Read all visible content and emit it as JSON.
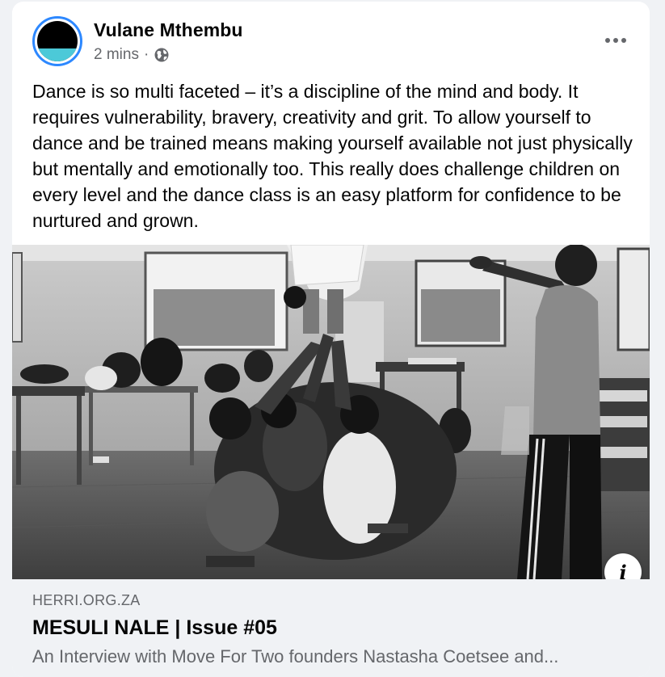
{
  "post": {
    "author": "Vulane Mthembu",
    "timestamp": "2 mins",
    "separator": "·",
    "privacy_icon": "globe-icon",
    "more_icon": "more-horizontal-icon",
    "text": "Dance is so multi faceted – it’s a discipline of the mind and body. It requires vulnerability, bravery, creativity and grit. To allow yourself to dance and be trained means making yourself available not just physically but mentally and emotionally too. This really does challenge children on every level and the dance class is an easy platform for confidence to be nurtured and grown."
  },
  "link_preview": {
    "domain": "HERRI.ORG.ZA",
    "title": "MESULI NALE | Issue #05",
    "description": "An Interview with Move For Two founders Nastasha Coetsee and...",
    "info_icon": "info-icon"
  },
  "colors": {
    "accent_ring": "#2d88ff",
    "avatar_band": "#4cc9d8",
    "secondary_text": "#65676b",
    "link_bg": "#f0f2f5"
  }
}
